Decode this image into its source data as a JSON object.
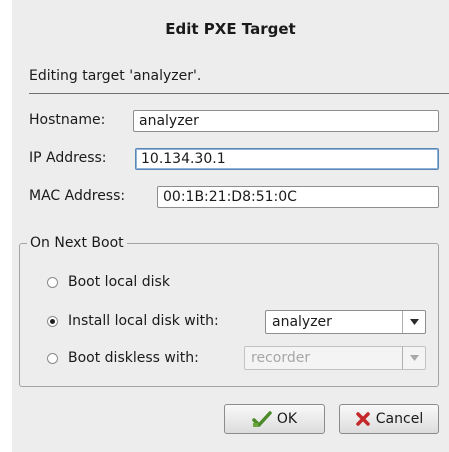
{
  "dialog": {
    "title": "Edit PXE Target",
    "intro": "Editing target 'analyzer'."
  },
  "fields": {
    "hostname_label": "Hostname:",
    "hostname_value": "analyzer",
    "ip_label": "IP Address:",
    "ip_value": "10.134.30.1",
    "mac_label": "MAC Address:",
    "mac_value": "00:1B:21:D8:51:0C"
  },
  "boot_group": {
    "legend": "On Next Boot",
    "options": [
      {
        "label": "Boot local disk",
        "checked": false
      },
      {
        "label": "Install local disk with:",
        "checked": true,
        "combo_value": "analyzer",
        "combo_enabled": true
      },
      {
        "label": "Boot diskless with:",
        "checked": false,
        "combo_value": "recorder",
        "combo_enabled": false
      }
    ]
  },
  "buttons": {
    "ok": "OK",
    "cancel": "Cancel"
  },
  "icons": {
    "ok": "green-check-icon",
    "cancel": "red-x-icon"
  },
  "colors": {
    "ok_icon": "#4c8a2a",
    "cancel_icon": "#c4282a",
    "focus_border": "#5a86b5"
  }
}
